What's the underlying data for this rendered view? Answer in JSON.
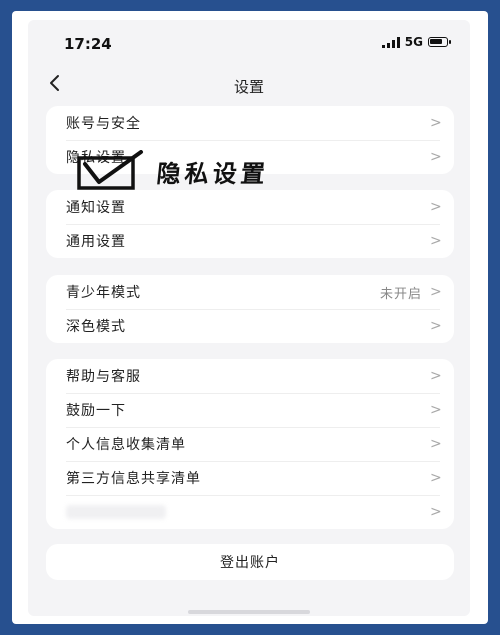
{
  "status_bar": {
    "time": "17:24",
    "network": "5G"
  },
  "nav": {
    "title": "设置"
  },
  "groups": [
    {
      "items": [
        {
          "label": "账号与安全",
          "value": ""
        },
        {
          "label": "隐私设置",
          "value": ""
        }
      ]
    },
    {
      "items": [
        {
          "label": "通知设置",
          "value": ""
        },
        {
          "label": "通用设置",
          "value": ""
        }
      ]
    },
    {
      "items": [
        {
          "label": "青少年模式",
          "value": "未开启"
        },
        {
          "label": "深色模式",
          "value": ""
        }
      ]
    },
    {
      "items": [
        {
          "label": "帮助与客服",
          "value": ""
        },
        {
          "label": "鼓励一下",
          "value": ""
        },
        {
          "label": "个人信息收集清单",
          "value": ""
        },
        {
          "label": "第三方信息共享清单",
          "value": ""
        }
      ]
    }
  ],
  "chevron": ">",
  "logout": {
    "label": "登出账户"
  },
  "annotation": {
    "text": "隐私设置"
  },
  "colors": {
    "border": "#27508f",
    "background": "#f4f4f6",
    "card": "#ffffff"
  }
}
